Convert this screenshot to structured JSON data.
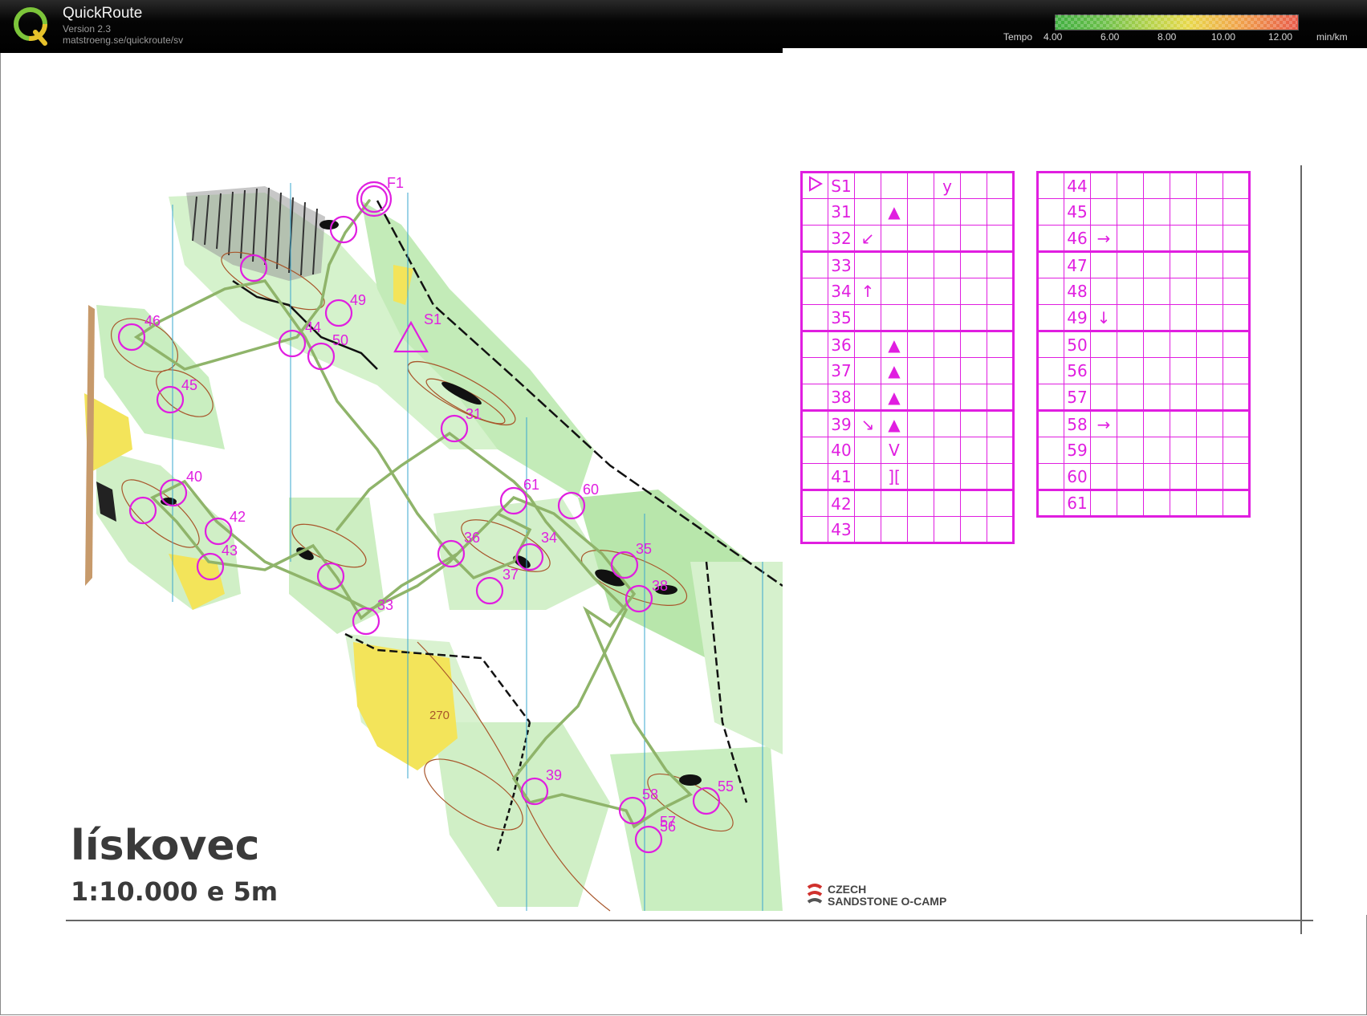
{
  "app": {
    "name": "QuickRoute",
    "version": "Version 2.3",
    "url": "matstroeng.se/quickroute/sv"
  },
  "tempo_legend": {
    "label": "Tempo",
    "ticks": [
      "4.00",
      "6.00",
      "8.00",
      "10.00",
      "12.00"
    ],
    "unit": "min/km"
  },
  "map": {
    "title": "lískovec",
    "scale": "1:10.000  e 5m",
    "contour_label": "270",
    "controls": [
      "F1",
      "S1",
      "31",
      "33",
      "34",
      "35",
      "36",
      "37",
      "38",
      "39",
      "40",
      "42",
      "43",
      "44",
      "45",
      "46",
      "49",
      "50",
      "55",
      "56",
      "57",
      "58",
      "60",
      "61"
    ],
    "brand_line1": "CZECH",
    "brand_line2": "SANDSTONE O-CAMP"
  },
  "description_left": {
    "rows": [
      {
        "code": "S1",
        "c1": "",
        "c2": "",
        "c3": "",
        "c4": "y"
      },
      {
        "code": "31",
        "c1": "",
        "c2": "▲",
        "c3": "",
        "c4": ""
      },
      {
        "code": "32",
        "c1": "↙",
        "c2": "",
        "c3": "",
        "c4": ""
      },
      {
        "code": "33",
        "c1": "",
        "c2": "",
        "c3": "",
        "c4": ""
      },
      {
        "code": "34",
        "c1": "↑",
        "c2": "",
        "c3": "",
        "c4": ""
      },
      {
        "code": "35",
        "c1": "",
        "c2": "",
        "c3": "",
        "c4": ""
      },
      {
        "code": "36",
        "c1": "",
        "c2": "▲",
        "c3": "",
        "c4": ""
      },
      {
        "code": "37",
        "c1": "",
        "c2": "▲",
        "c3": "",
        "c4": ""
      },
      {
        "code": "38",
        "c1": "",
        "c2": "▲",
        "c3": "",
        "c4": ""
      },
      {
        "code": "39",
        "c1": "↘",
        "c2": "▲",
        "c3": "",
        "c4": ""
      },
      {
        "code": "40",
        "c1": "",
        "c2": "V",
        "c3": "",
        "c4": ""
      },
      {
        "code": "41",
        "c1": "",
        "c2": "][",
        "c3": "",
        "c4": ""
      },
      {
        "code": "42",
        "c1": "",
        "c2": "",
        "c3": "",
        "c4": ""
      },
      {
        "code": "43",
        "c1": "",
        "c2": "",
        "c3": "",
        "c4": ""
      }
    ]
  },
  "description_right": {
    "rows": [
      {
        "code": "44",
        "c1": "",
        "c2": "",
        "c3": ""
      },
      {
        "code": "45",
        "c1": "",
        "c2": "",
        "c3": ""
      },
      {
        "code": "46",
        "c1": "→",
        "c2": "",
        "c3": ""
      },
      {
        "code": "47",
        "c1": "",
        "c2": "",
        "c3": ""
      },
      {
        "code": "48",
        "c1": "",
        "c2": "",
        "c3": ""
      },
      {
        "code": "49",
        "c1": "↓",
        "c2": "",
        "c3": ""
      },
      {
        "code": "50",
        "c1": "",
        "c2": "",
        "c3": ""
      },
      {
        "code": "56",
        "c1": "",
        "c2": "",
        "c3": ""
      },
      {
        "code": "57",
        "c1": "",
        "c2": "",
        "c3": ""
      },
      {
        "code": "58",
        "c1": "→",
        "c2": "",
        "c3": ""
      },
      {
        "code": "59",
        "c1": "",
        "c2": "",
        "c3": ""
      },
      {
        "code": "60",
        "c1": "",
        "c2": "",
        "c3": ""
      },
      {
        "code": "61",
        "c1": "",
        "c2": "",
        "c3": ""
      }
    ]
  },
  "colors": {
    "course": "#e01ee0",
    "route": "#8fb46a",
    "forest": "#b9e6ad",
    "open": "#f2e24a",
    "contour": "#a8562b"
  }
}
